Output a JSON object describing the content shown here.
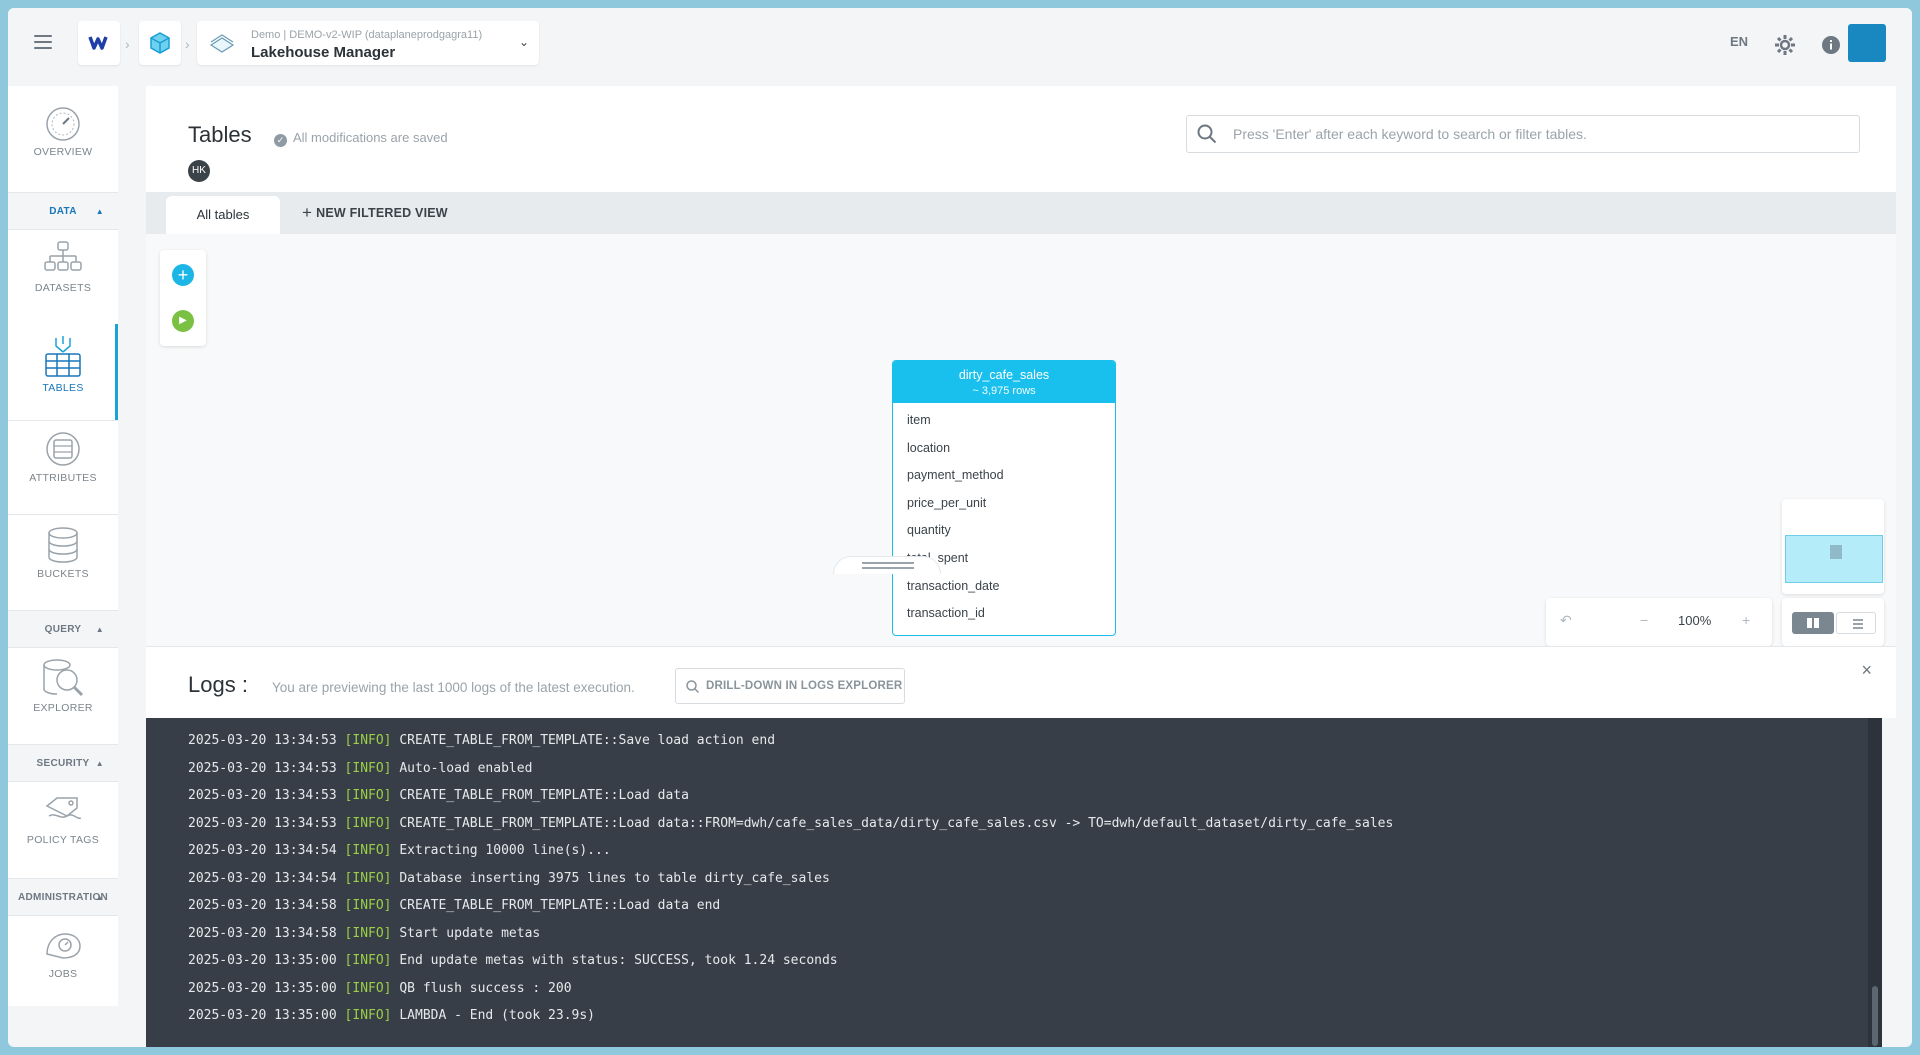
{
  "topbar": {
    "project_sub": "Demo | DEMO-v2-WIP (dataplaneprodgagra11)",
    "project_title": "Lakehouse Manager",
    "language": "EN"
  },
  "sidebar": {
    "items": [
      {
        "label": "OVERVIEW",
        "icon": "speedometer-icon"
      },
      {
        "label": "DATASETS",
        "icon": "datasets-icon"
      },
      {
        "label": "TABLES",
        "icon": "tables-icon",
        "active": true
      },
      {
        "label": "ATTRIBUTES",
        "icon": "attributes-icon"
      },
      {
        "label": "BUCKETS",
        "icon": "buckets-icon"
      },
      {
        "label": "EXPLORER",
        "icon": "explorer-icon"
      },
      {
        "label": "POLICY TAGS",
        "icon": "policy-tags-icon"
      },
      {
        "label": "JOBS",
        "icon": "jobs-icon"
      }
    ],
    "sections": {
      "data": "DATA",
      "query": "QUERY",
      "security": "SECURITY",
      "administration": "ADMINISTRATION"
    }
  },
  "main": {
    "title": "Tables",
    "saved_status": "All modifications are saved",
    "user_initials": "HK",
    "search_placeholder": "Press 'Enter' after each keyword to search or filter tables.",
    "tabs": {
      "active": "All tables",
      "new_view": "NEW FILTERED VIEW"
    }
  },
  "table_card": {
    "name": "dirty_cafe_sales",
    "rows": "~ 3,975 rows",
    "columns": [
      "item",
      "location",
      "payment_method",
      "price_per_unit",
      "quantity",
      "total_spent",
      "transaction_date",
      "transaction_id"
    ]
  },
  "zoom": {
    "level": "100%",
    "minus": "−",
    "plus": "+"
  },
  "logs": {
    "title": "Logs :",
    "subtitle": "You are previewing the last 1000 logs of the latest execution.",
    "drill_button": "DRILL-DOWN IN LOGS EXPLORER",
    "close": "×",
    "lines": [
      {
        "ts": "2025-03-20 13:34:53",
        "level": "[INFO]",
        "msg": "CREATE_TABLE_FROM_TEMPLATE::Save load action end"
      },
      {
        "ts": "2025-03-20 13:34:53",
        "level": "[INFO]",
        "msg": "Auto-load enabled"
      },
      {
        "ts": "2025-03-20 13:34:53",
        "level": "[INFO]",
        "msg": "CREATE_TABLE_FROM_TEMPLATE::Load data"
      },
      {
        "ts": "2025-03-20 13:34:53",
        "level": "[INFO]",
        "msg": "CREATE_TABLE_FROM_TEMPLATE::Load data::FROM=dwh/cafe_sales_data/dirty_cafe_sales.csv -> TO=dwh/default_dataset/dirty_cafe_sales"
      },
      {
        "ts": "2025-03-20 13:34:54",
        "level": "[INFO]",
        "msg": "Extracting 10000 line(s)..."
      },
      {
        "ts": "2025-03-20 13:34:54",
        "level": "[INFO]",
        "msg": "Database inserting 3975 lines to table dirty_cafe_sales"
      },
      {
        "ts": "2025-03-20 13:34:58",
        "level": "[INFO]",
        "msg": "CREATE_TABLE_FROM_TEMPLATE::Load data end"
      },
      {
        "ts": "2025-03-20 13:34:58",
        "level": "[INFO]",
        "msg": "Start update metas"
      },
      {
        "ts": "2025-03-20 13:35:00",
        "level": "[INFO]",
        "msg": "End update metas with status: SUCCESS, took 1.24 seconds"
      },
      {
        "ts": "2025-03-20 13:35:00",
        "level": "[INFO]",
        "msg": "QB flush success : 200"
      },
      {
        "ts": "2025-03-20 13:35:00",
        "level": "[INFO]",
        "msg": "LAMBDA - End (took 23.9s)"
      }
    ]
  },
  "colors": {
    "accent": "#19c0ee",
    "active_nav": "#1877b8",
    "log_level": "#9bcf47",
    "log_bg": "#373e47"
  }
}
